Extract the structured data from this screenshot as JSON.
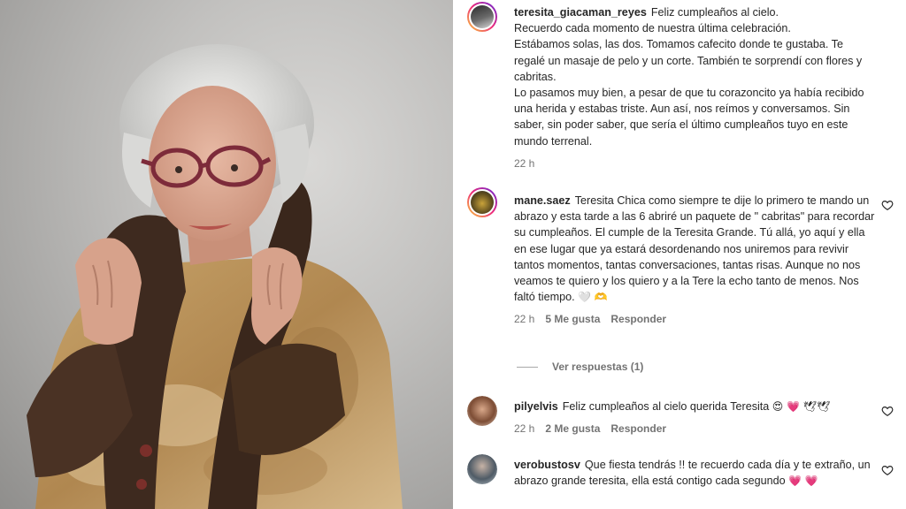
{
  "photo": {
    "description_icon": "portrait-photo"
  },
  "comments": [
    {
      "username": "teresita_giacaman_reyes",
      "text": "Feliz cumpleaños al cielo.\nRecuerdo cada momento de nuestra última celebración.\nEstábamos solas, las dos. Tomamos cafecito donde te gustaba. Te regalé un masaje de pelo y un corte. También te sorprendí con flores y cabritas.\nLo pasamos muy bien, a pesar de que tu corazoncito ya había recibido una herida y estabas triste. Aun así, nos reímos y conversamos. Sin saber, sin poder saber, que sería el último cumpleaños tuyo en este mundo terrenal.",
      "time": "22 h"
    },
    {
      "username": "mane.saez",
      "text": "Teresita Chica como siempre te dije lo primero te mando un abrazo y esta tarde a las 6 abriré un paquete de \" cabritas\" para recordar su cumpleaños. El cumple de la Teresita Grande. Tú allá, yo aquí y ella en ese lugar que ya estará desordenando nos uniremos para revivir tantos momentos, tantas conversaciones, tantas risas. Aunque no nos veamos te quiero y los quiero y a la Tere la echo tanto de menos. Nos faltó tiempo.",
      "emoji": "🤍 🫶",
      "time": "22 h",
      "likes": "5 Me gusta",
      "reply": "Responder",
      "view_replies": "Ver respuestas (1)"
    },
    {
      "username": "pilyelvis",
      "text": "Feliz cumpleaños al cielo querida Teresita",
      "emoji": "😍 💗 🕊🕊",
      "time": "22 h",
      "likes": "2 Me gusta",
      "reply": "Responder"
    },
    {
      "username": "verobustosv",
      "text": "Que fiesta tendrás !! te recuerdo cada día y te extraño, un abrazo grande teresita, ella está contigo cada segundo",
      "emoji": "💗 💗"
    }
  ],
  "colors": {
    "muted": "#737373",
    "text": "#262626",
    "heart_outline": "#262626"
  },
  "icons": {
    "like": "heart-outline-icon"
  }
}
